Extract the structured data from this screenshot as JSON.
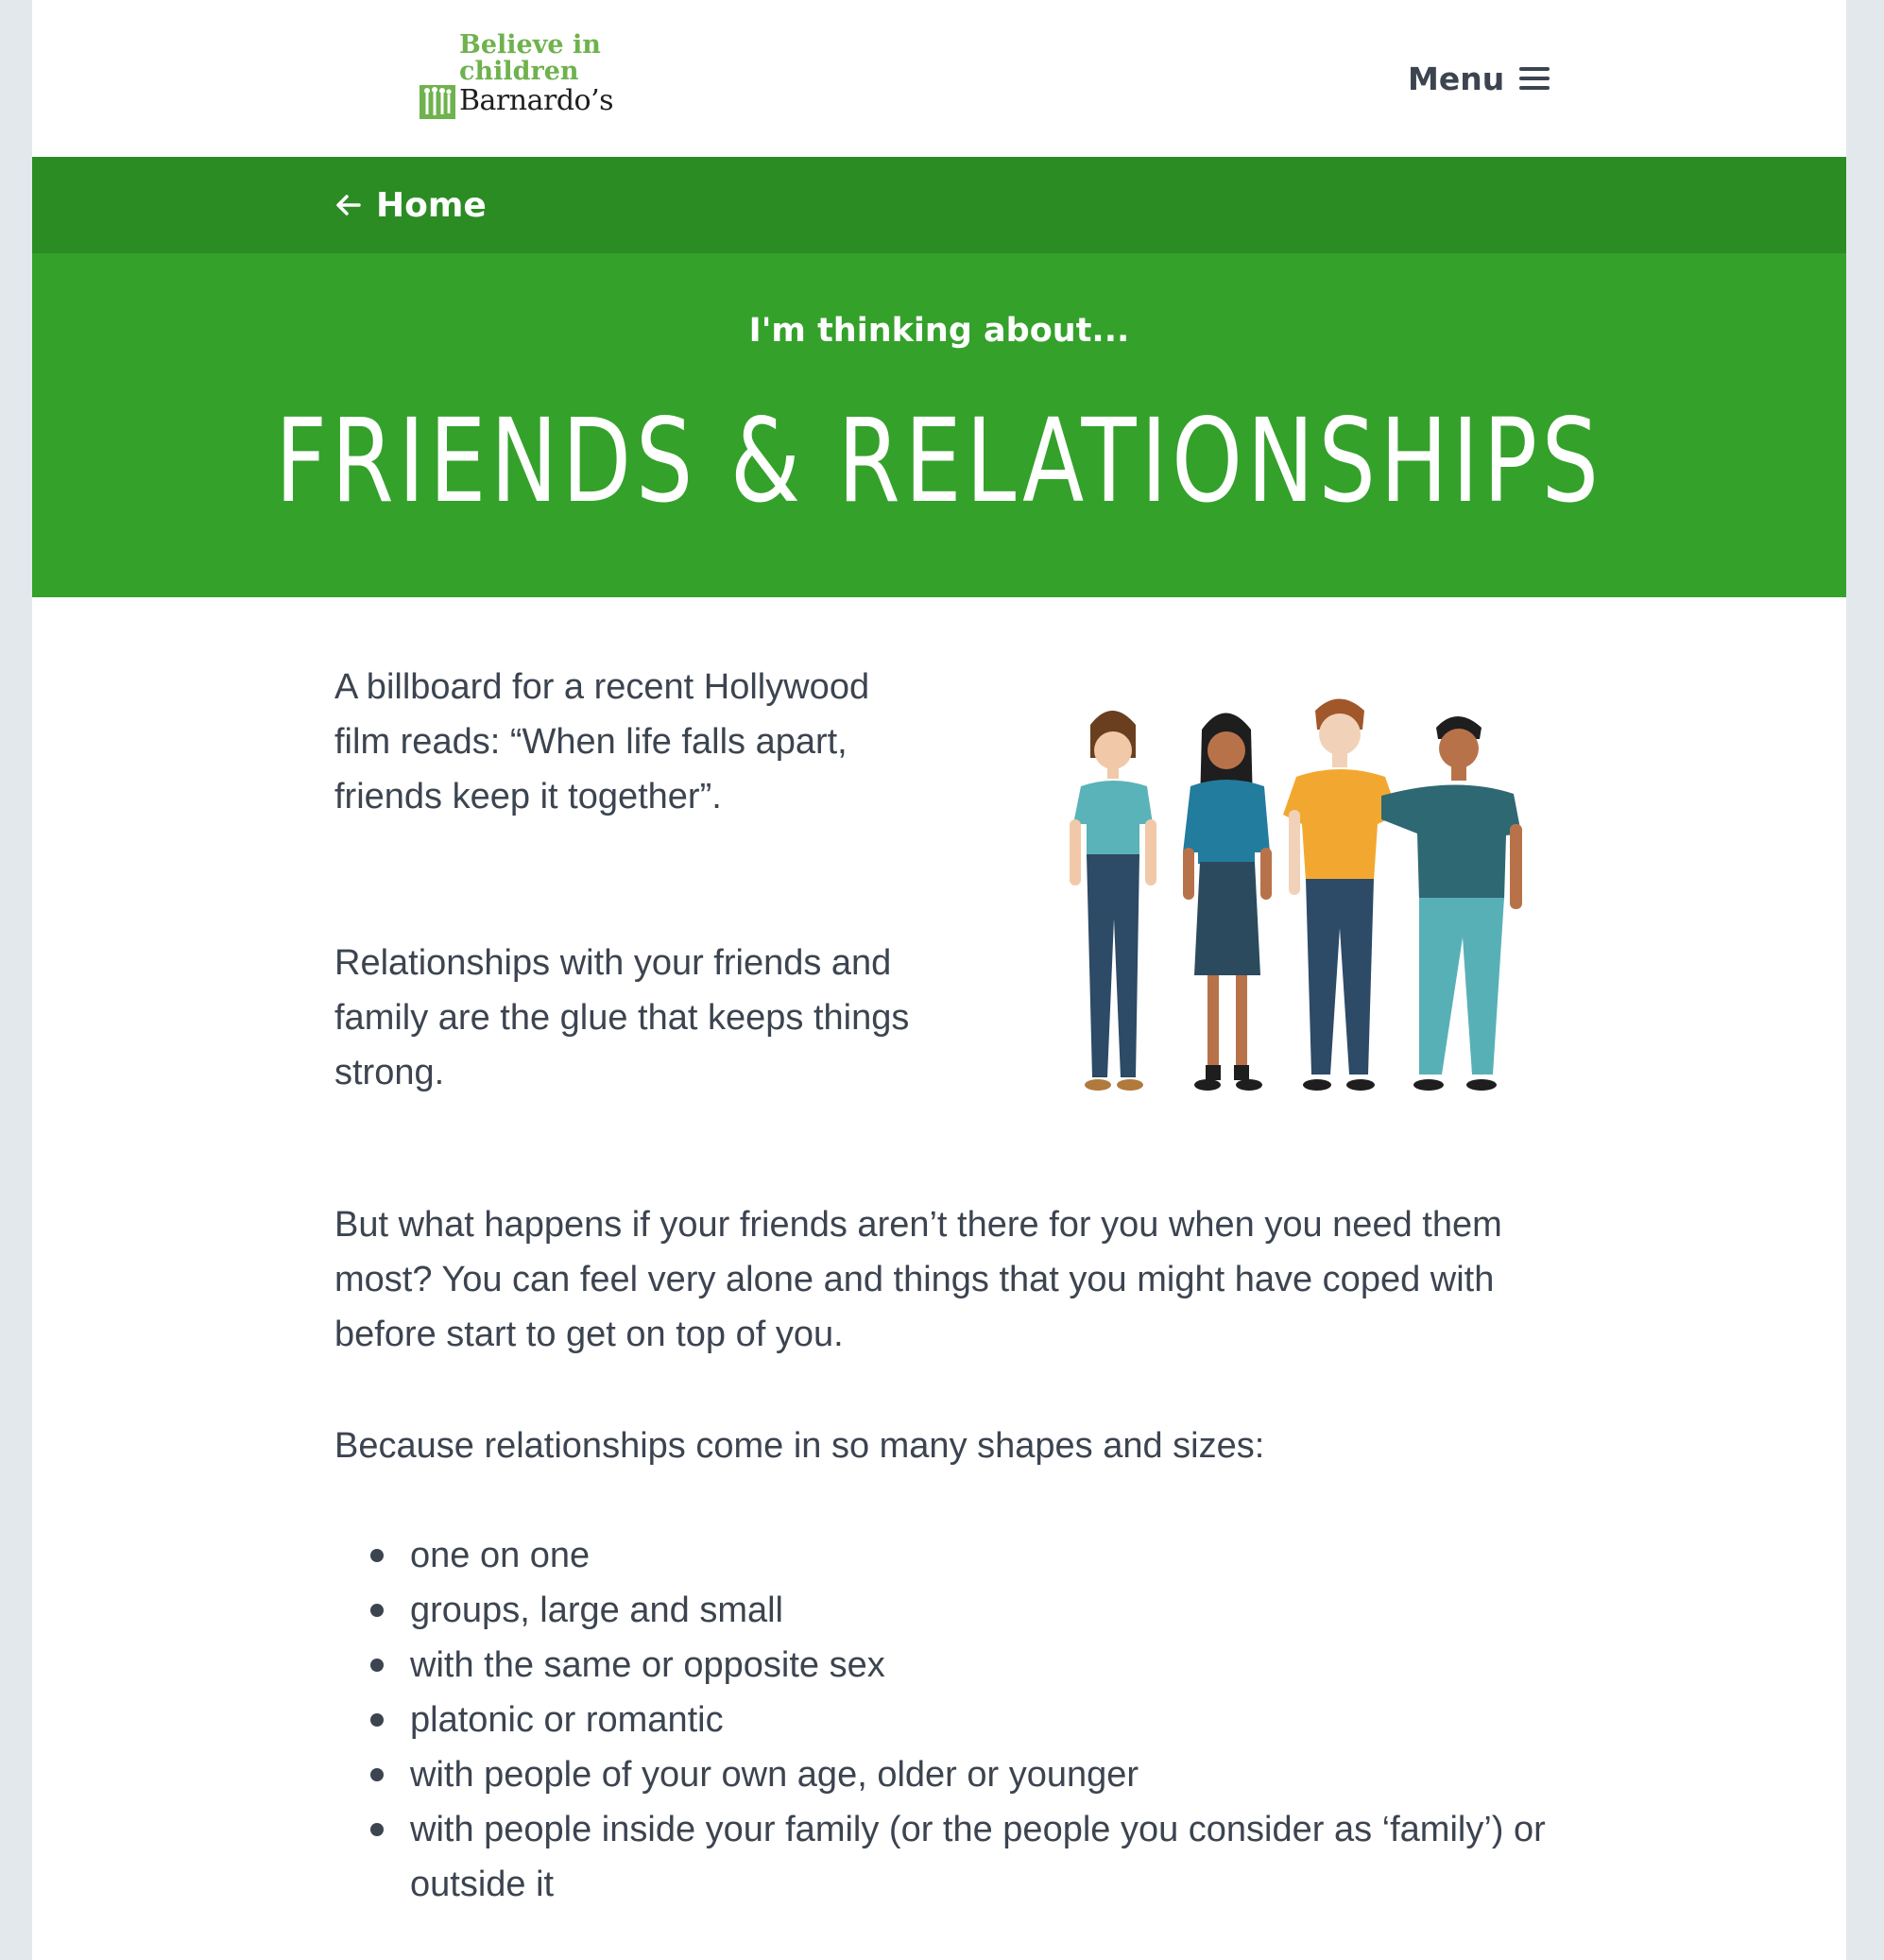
{
  "header": {
    "logo": {
      "tagline_line1": "Believe in",
      "tagline_line2": "children",
      "name": "Barnardo’s",
      "tagline_color": "#6fb24e"
    },
    "menu_label": "Menu",
    "menu_icon": "hamburger-icon"
  },
  "breadcrumb": {
    "home_label": "Home",
    "icon": "arrow-left-icon",
    "bar_color": "#2b8c24"
  },
  "hero": {
    "kicker": "I'm thinking about...",
    "title": "FRIENDS & RELATIONSHIPS",
    "background_color": "#34a12b"
  },
  "content": {
    "paragraphs": [
      "A billboard for a recent Hollywood film reads: “When life falls apart, friends keep it together”.",
      "Relationships with your friends and family are the glue that keeps things strong.",
      "But what happens if your friends aren’t there for you when you need them most? You can feel very alone and things that you might have coped with before start to get on top of you.",
      "Because relationships come in so many shapes and sizes:"
    ],
    "illustration": "group-of-four-friends-illustration",
    "bullets": [
      "one on one",
      "groups, large and small",
      "with the same or opposite sex",
      "platonic or romantic",
      "with people of your own age, older or younger",
      "with people inside your family (or the people you consider as ‘family’) or outside it"
    ]
  },
  "colors": {
    "text": "#3c4450",
    "page_background": "#e3e8ec"
  }
}
